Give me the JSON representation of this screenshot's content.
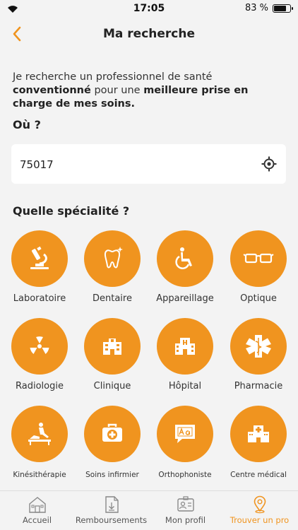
{
  "status_bar": {
    "time": "17:05",
    "battery": "83 %",
    "battery_level": 0.83
  },
  "nav": {
    "title": "Ma recherche",
    "back_icon": "chevron-left-icon"
  },
  "intro": {
    "part1": "Je recherche un professionnel de santé ",
    "bold1": "conventionné",
    "part2": " pour une ",
    "bold2": "meilleure prise en charge de mes soins."
  },
  "where": {
    "title": "Où ?",
    "value": "75017",
    "locate_icon": "crosshair-icon"
  },
  "specialty": {
    "title": "Quelle spécialité ?",
    "items": [
      {
        "label": "Laboratoire",
        "icon": "microscope-icon"
      },
      {
        "label": "Dentaire",
        "icon": "tooth-icon"
      },
      {
        "label": "Appareillage",
        "icon": "wheelchair-icon"
      },
      {
        "label": "Optique",
        "icon": "glasses-icon"
      },
      {
        "label": "Radiologie",
        "icon": "radiation-icon"
      },
      {
        "label": "Clinique",
        "icon": "clinic-icon"
      },
      {
        "label": "Hôpital",
        "icon": "hospital-icon"
      },
      {
        "label": "Pharmacie",
        "icon": "caduceus-icon"
      },
      {
        "label": "Kinésithérapie",
        "icon": "physiotherapy-icon"
      },
      {
        "label": "Soins infirmier",
        "icon": "first-aid-kit-icon"
      },
      {
        "label": "Orthophoniste",
        "icon": "speech-bubble-icon"
      },
      {
        "label": "Centre médical",
        "icon": "medical-center-icon"
      }
    ]
  },
  "tabs": [
    {
      "label": "Accueil",
      "icon": "home-icon",
      "active": false
    },
    {
      "label": "Remboursements",
      "icon": "document-icon",
      "active": false
    },
    {
      "label": "Mon profil",
      "icon": "id-card-icon",
      "active": false
    },
    {
      "label": "Trouver un pro",
      "icon": "map-pin-icon",
      "active": true
    }
  ],
  "colors": {
    "accent": "#f0941f",
    "background": "#f3f3f3",
    "text": "#333333"
  }
}
